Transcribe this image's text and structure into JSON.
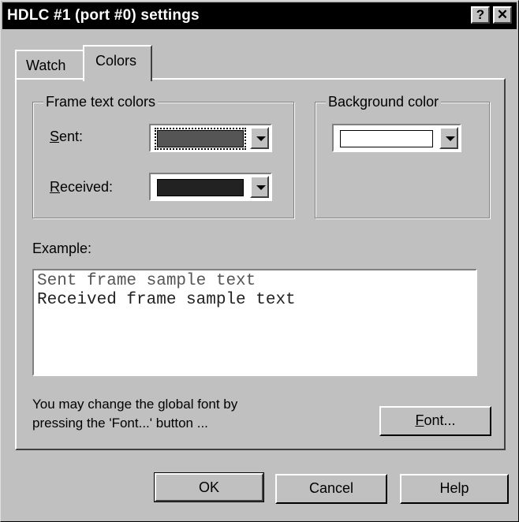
{
  "window": {
    "title": "HDLC #1 (port #0) settings",
    "help_glyph": "?",
    "close_glyph": "✕"
  },
  "tabs": [
    {
      "label": "Watch",
      "active": false
    },
    {
      "label": "Colors",
      "active": true
    }
  ],
  "frame_text_colors": {
    "legend": "Frame text colors",
    "sent": {
      "label_accel": "S",
      "label_rest": "ent:",
      "color": "#555555"
    },
    "received": {
      "label_accel": "R",
      "label_rest": "eceived:",
      "color": "#222222"
    }
  },
  "background_color": {
    "legend": "Background color",
    "color": "#ffffff"
  },
  "example": {
    "label": "Example:",
    "sent_text": "Sent frame sample text",
    "received_text": "Received frame sample text"
  },
  "font_hint": {
    "line1": "You may change the global font by",
    "line2": "pressing the 'Font...' button ..."
  },
  "buttons": {
    "font": {
      "accel": "F",
      "rest": "ont..."
    },
    "ok": "OK",
    "cancel": "Cancel",
    "help": "Help"
  }
}
